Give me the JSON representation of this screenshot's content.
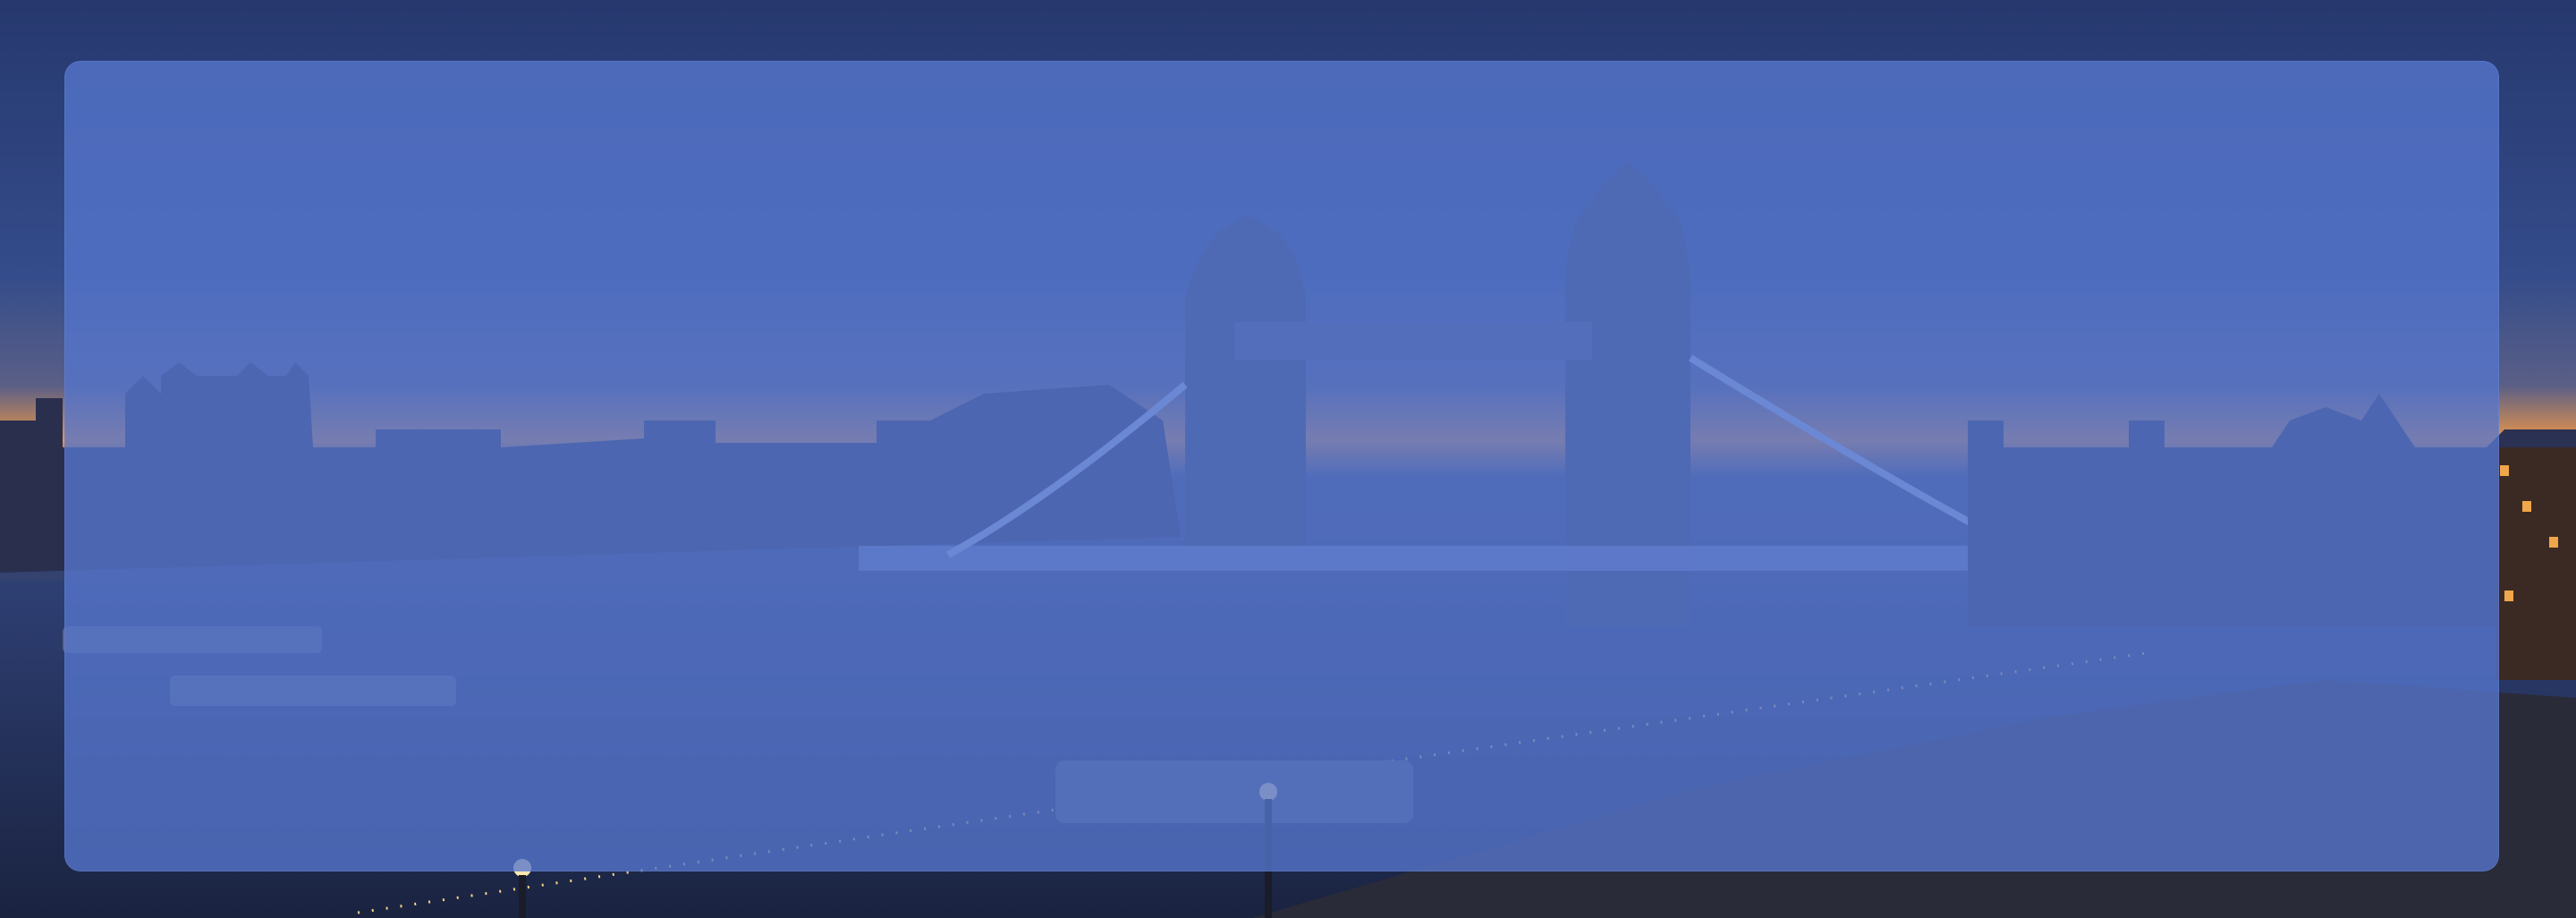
{
  "hero": {
    "image": "london-tower-bridge-dusk",
    "overlay_color": "#5676cd",
    "sky_colors": [
      "#2b3f7a",
      "#3c5699",
      "#e8954b"
    ]
  }
}
